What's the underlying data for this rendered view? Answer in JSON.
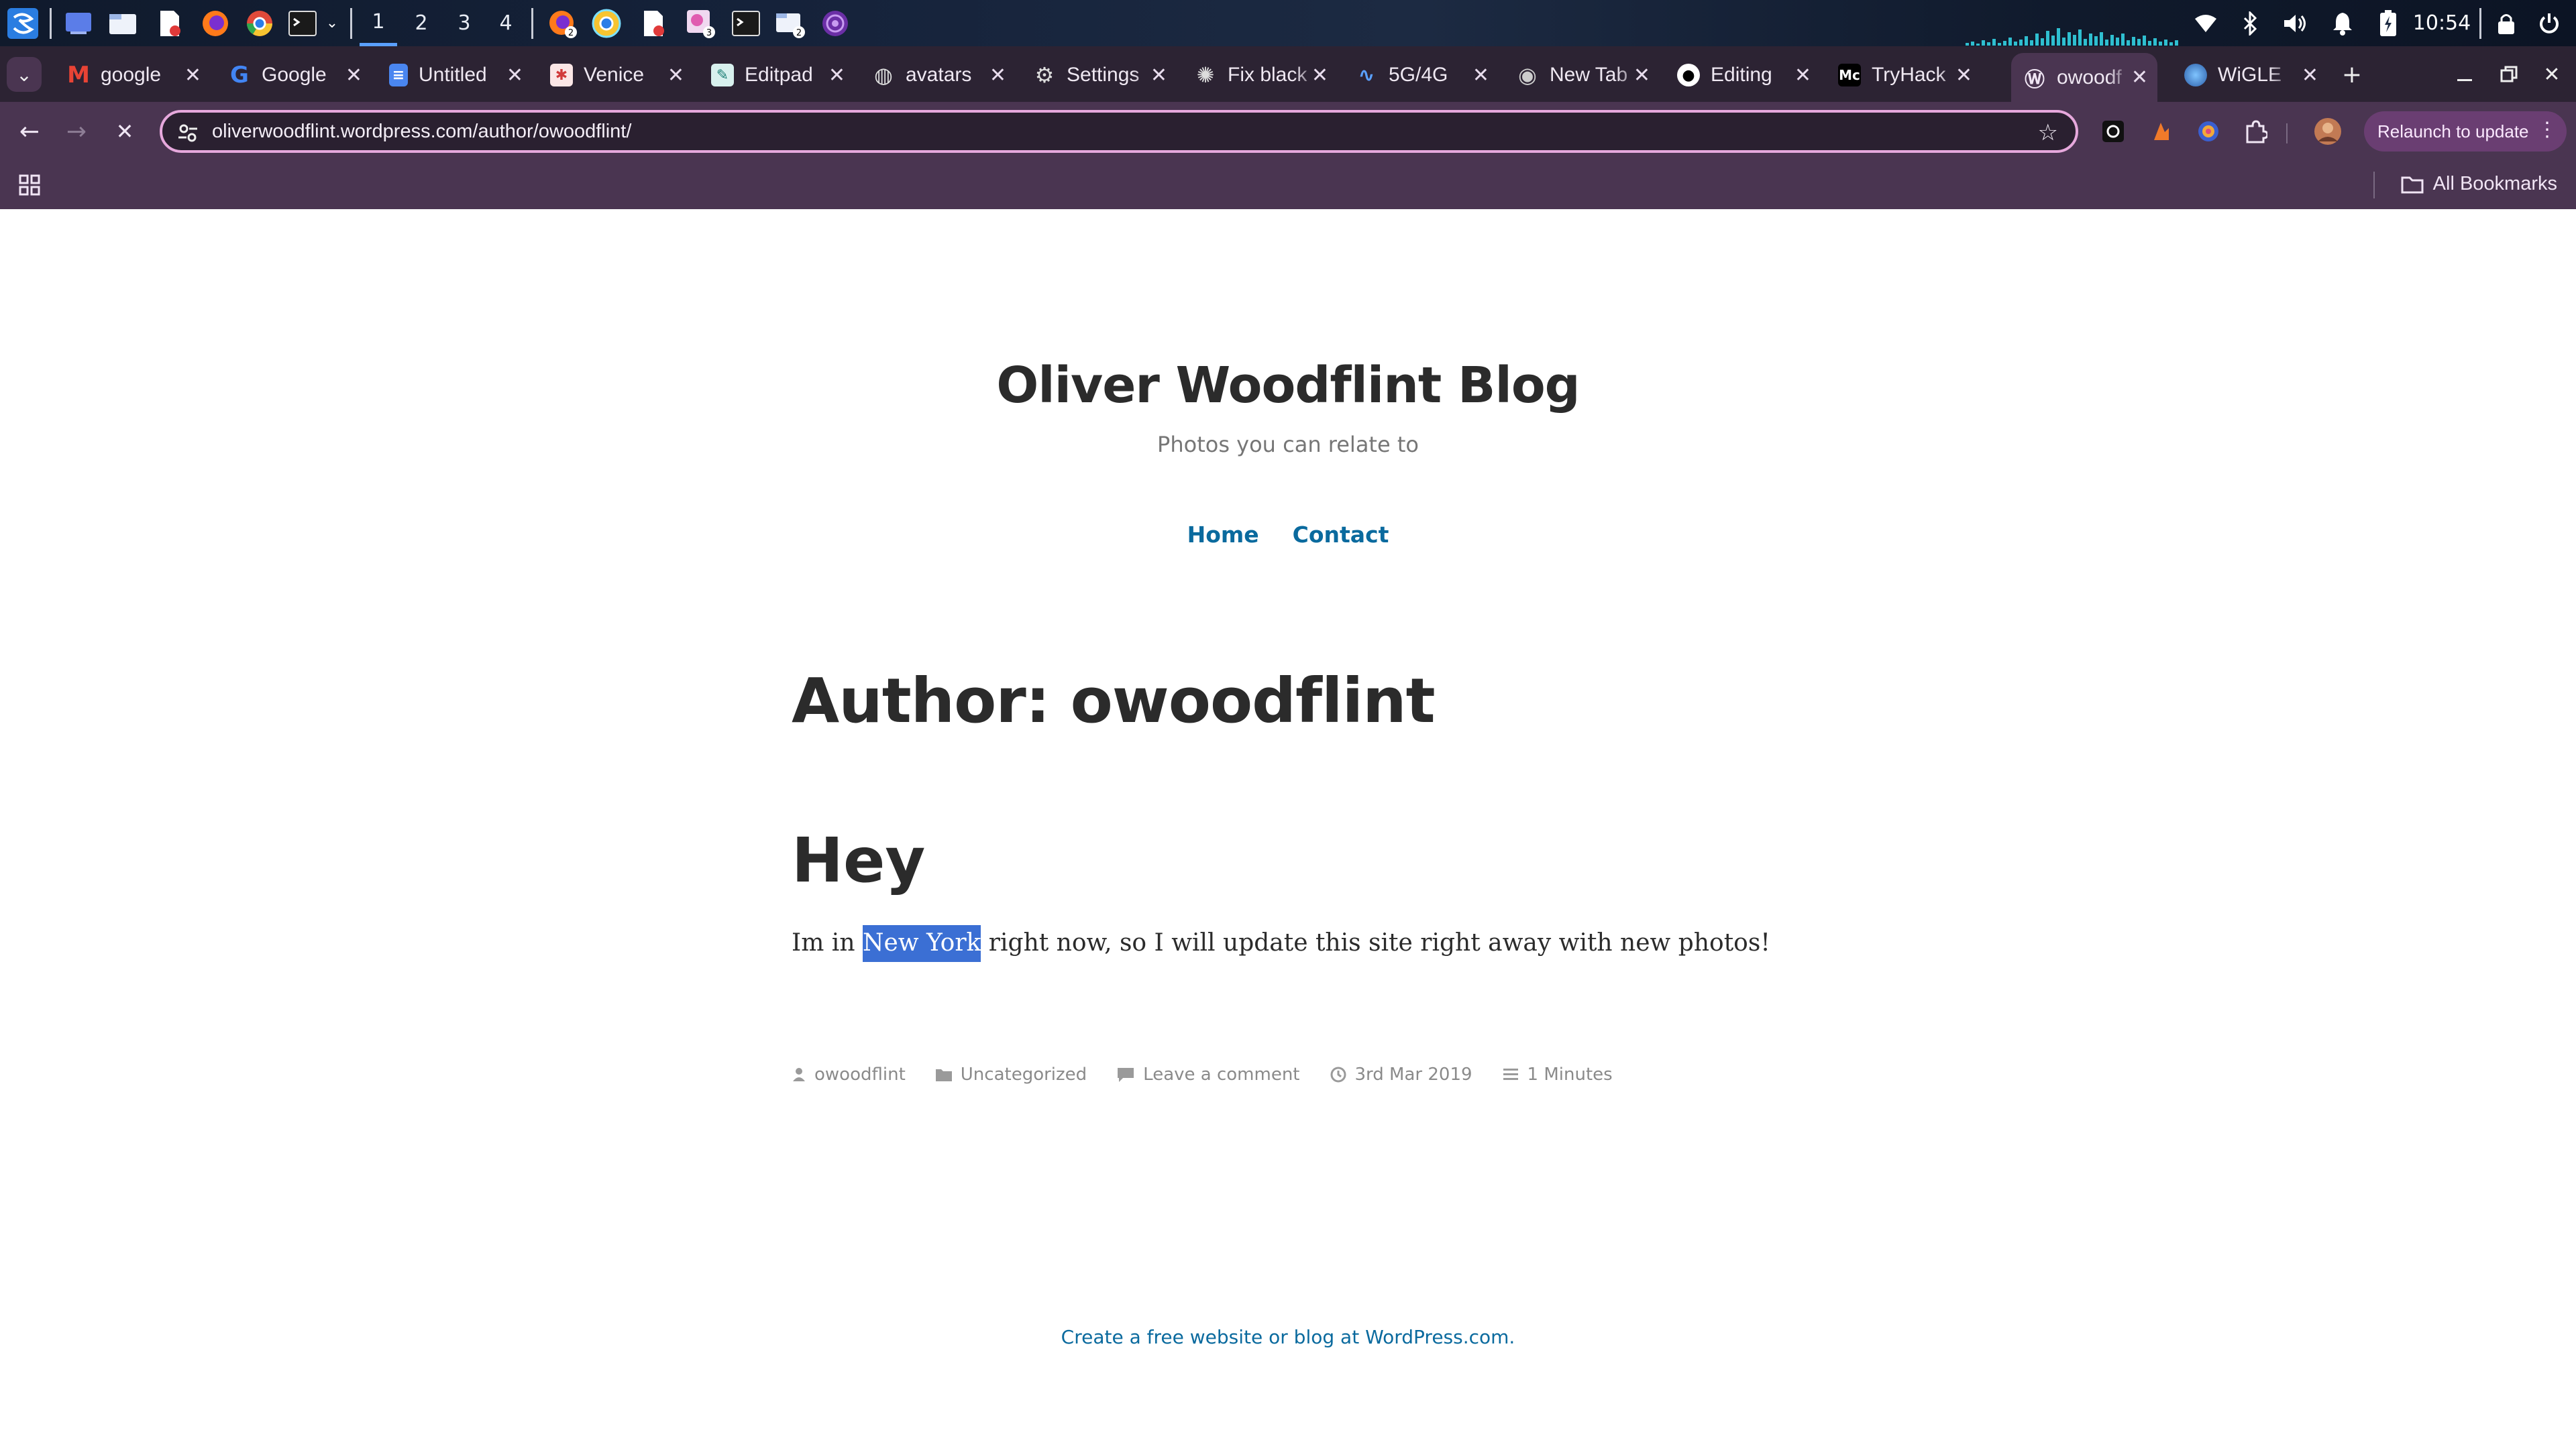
{
  "taskbar": {
    "workspaces": [
      "1",
      "2",
      "3",
      "4"
    ],
    "active_workspace": "1",
    "clock": "10:54",
    "badges": {
      "firefox": "2",
      "pics": "3",
      "files": "2"
    }
  },
  "tabs": [
    {
      "title": "google",
      "icon": "gmail-icon"
    },
    {
      "title": "Google",
      "icon": "google-icon"
    },
    {
      "title": "Untitled",
      "icon": "docs-icon"
    },
    {
      "title": "Venice",
      "icon": "venice-icon"
    },
    {
      "title": "Editpad",
      "icon": "editpad-icon"
    },
    {
      "title": "avatars",
      "icon": "globe-icon"
    },
    {
      "title": "Settings",
      "icon": "gear-icon"
    },
    {
      "title": "Fix black",
      "icon": "openai-icon"
    },
    {
      "title": "5G/4G",
      "icon": "5g-icon"
    },
    {
      "title": "New Tab",
      "icon": "chrome-icon"
    },
    {
      "title": "Editing",
      "icon": "github-icon"
    },
    {
      "title": "TryHack",
      "icon": "medium-icon"
    },
    {
      "title": "owoodf",
      "icon": "wordpress-icon",
      "active": true
    },
    {
      "title": "WiGLE",
      "icon": "wigle-icon"
    }
  ],
  "toolbar": {
    "url": "oliverwoodflint.wordpress.com/author/owoodflint/",
    "relaunch_label": "Relaunch to update"
  },
  "bookmarks": {
    "all_bookmarks_label": "All Bookmarks"
  },
  "site": {
    "title": "Oliver Woodflint Blog",
    "tagline": "Photos you can relate to",
    "menu": [
      "Home",
      "Contact"
    ]
  },
  "archive": {
    "title": "Author: owoodflint"
  },
  "post": {
    "title": "Hey",
    "body_before": "Im in ",
    "body_highlight": "New York",
    "body_after": " right now, so I will update this site right away with new photos!",
    "meta": {
      "author": "owoodflint",
      "category": "Uncategorized",
      "comments": "Leave a comment",
      "date": "3rd Mar 2019",
      "reading_time": "1 Minutes"
    }
  },
  "footer": {
    "link": "Create a free website or blog at WordPress.com."
  },
  "colors": {
    "link": "#0a6a9e",
    "selection": "#3b6fd4",
    "chrome_toolbar": "#4a3551",
    "tabstrip": "#2c2333"
  }
}
